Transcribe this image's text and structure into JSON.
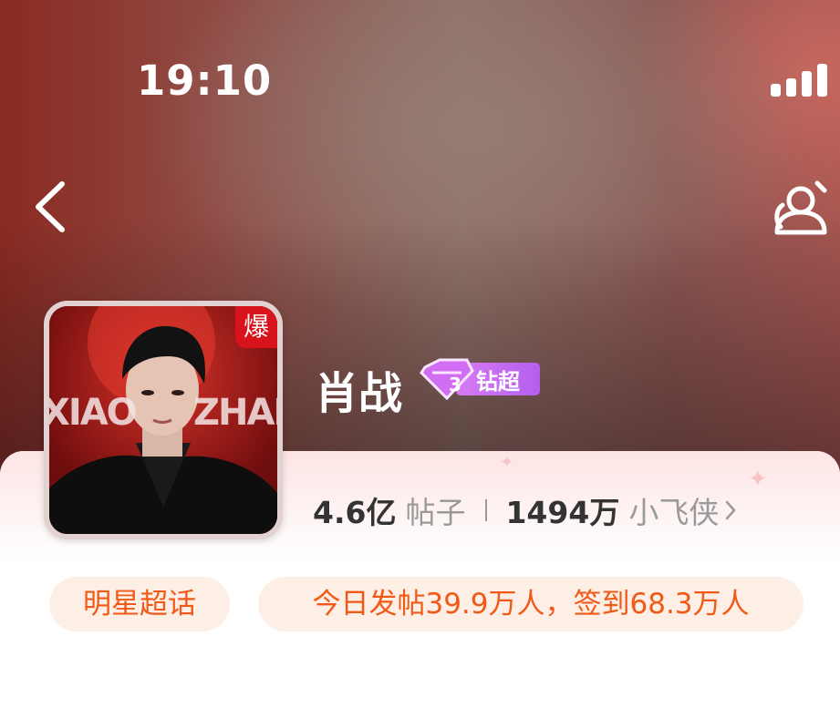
{
  "status_bar": {
    "time": "19:10"
  },
  "header": {
    "back_icon": "chevron-left-icon",
    "follow_icon": "add-follow-icon"
  },
  "topic": {
    "name": "肖战",
    "avatar_badge": "爆",
    "tier_badge": {
      "label": "钻超",
      "icon": "diamond-icon"
    },
    "avatar_text": {
      "left": "XIAO",
      "right": "ZHAN"
    }
  },
  "stats": {
    "posts_value": "4.6亿",
    "posts_label": "帖子",
    "fans_value": "1494万",
    "fans_label": "小飞侠"
  },
  "tags": {
    "category": "明星超话",
    "activity": "今日发帖39.9万人，签到68.3万人"
  },
  "colors": {
    "accent_orange": "#f05a16",
    "tag_bg": "#fdeee6",
    "badge_red": "#d8131b",
    "tier_purple": "#c86af0"
  }
}
